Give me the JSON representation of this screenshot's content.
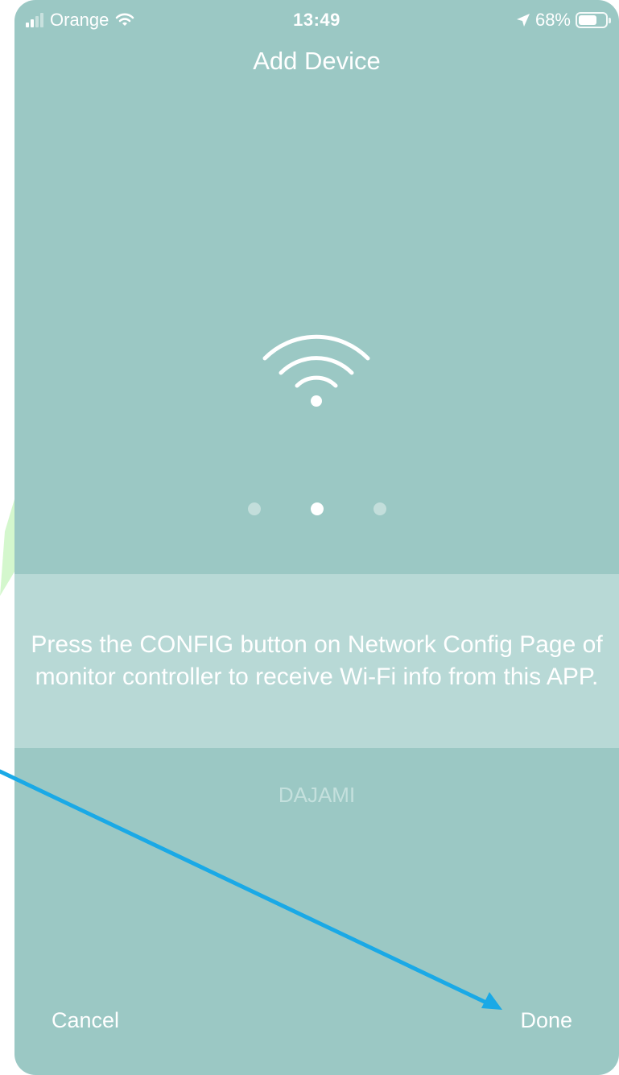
{
  "status_bar": {
    "carrier": "Orange",
    "time": "13:49",
    "battery_percent": "68%",
    "battery_level": 0.68,
    "icons": [
      "signal-bars-icon",
      "wifi-icon",
      "location-arrow-icon",
      "battery-icon"
    ]
  },
  "header": {
    "title": "Add Device"
  },
  "illustration": {
    "icon": "wifi-icon"
  },
  "pager": {
    "count": 3,
    "active_index": 1
  },
  "instruction": {
    "text": "Press the CONFIG button on Network Config Page of monitor controller to receive Wi-Fi info from this APP."
  },
  "network": {
    "ssid": "DAJAMI"
  },
  "footer": {
    "cancel_label": "Cancel",
    "done_label": "Done"
  },
  "colors": {
    "background": "#9bc8c4",
    "panel": "#b8d9d6",
    "annotation_arrow": "#1aa9e6",
    "annotation_green": "#b9f2b0"
  }
}
